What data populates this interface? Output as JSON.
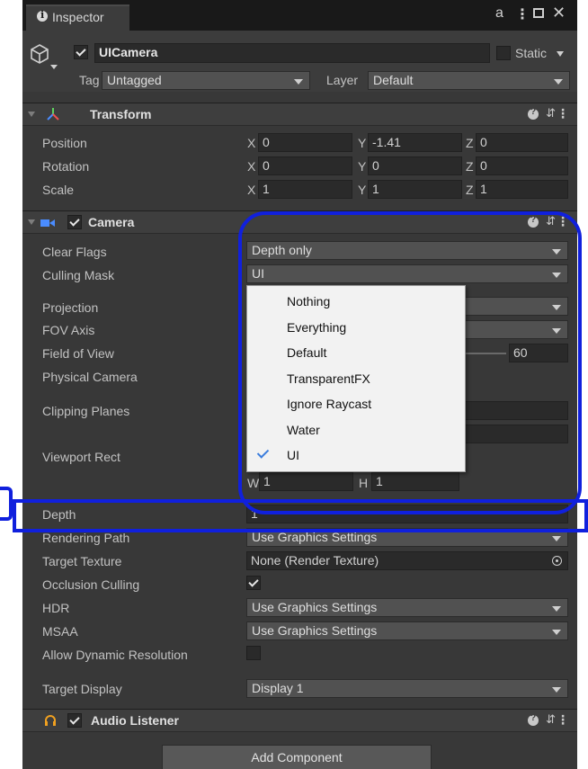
{
  "window": {
    "tab_title": "Inspector",
    "icon": "info-icon",
    "controls": [
      "lock-icon",
      "more-vert-icon",
      "maximize-icon",
      "close-icon"
    ]
  },
  "gameobject": {
    "active": true,
    "name": "UICamera",
    "static_label": "Static",
    "tag_label": "Tag",
    "tag_value": "Untagged",
    "layer_label": "Layer",
    "layer_value": "Default"
  },
  "transform": {
    "title": "Transform",
    "rows": [
      {
        "label": "Position",
        "x": "0",
        "y": "-1.41",
        "z": "0"
      },
      {
        "label": "Rotation",
        "x": "0",
        "y": "0",
        "z": "0"
      },
      {
        "label": "Scale",
        "x": "1",
        "y": "1",
        "z": "1"
      }
    ],
    "axes": {
      "x": "X",
      "y": "Y",
      "z": "Z"
    }
  },
  "camera": {
    "title": "Camera",
    "clear_flags_label": "Clear Flags",
    "clear_flags_value": "Depth only",
    "culling_mask_label": "Culling Mask",
    "culling_mask_value": "UI",
    "projection_label": "Projection",
    "fov_axis_label": "FOV Axis",
    "fov_label": "Field of View",
    "fov_value": "60",
    "physical_label": "Physical Camera",
    "clipping_label": "Clipping Planes",
    "viewport_label": "Viewport Rect",
    "viewport_w_label": "W",
    "viewport_w": "1",
    "viewport_h_label": "H",
    "viewport_h": "1",
    "depth_label": "Depth",
    "depth_value": "1",
    "rendering_path_label": "Rendering Path",
    "rendering_path_value": "Use Graphics Settings",
    "target_texture_label": "Target Texture",
    "target_texture_value": "None (Render Texture)",
    "occlusion_label": "Occlusion Culling",
    "occlusion_on": true,
    "hdr_label": "HDR",
    "hdr_value": "Use Graphics Settings",
    "msaa_label": "MSAA",
    "msaa_value": "Use Graphics Settings",
    "dynres_label": "Allow Dynamic Resolution",
    "dynres_on": false,
    "target_display_label": "Target Display",
    "target_display_value": "Display 1"
  },
  "culling_menu": {
    "items": [
      "Nothing",
      "Everything",
      "Default",
      "TransparentFX",
      "Ignore Raycast",
      "Water",
      "UI"
    ],
    "checked": "UI"
  },
  "audio_listener": {
    "title": "Audio Listener"
  },
  "add_component_label": "Add Component",
  "colors": {
    "annotation": "#1020dd",
    "panel": "#383838",
    "menu_bg": "#f2f2f2",
    "check_blue": "#3b7ddd"
  }
}
